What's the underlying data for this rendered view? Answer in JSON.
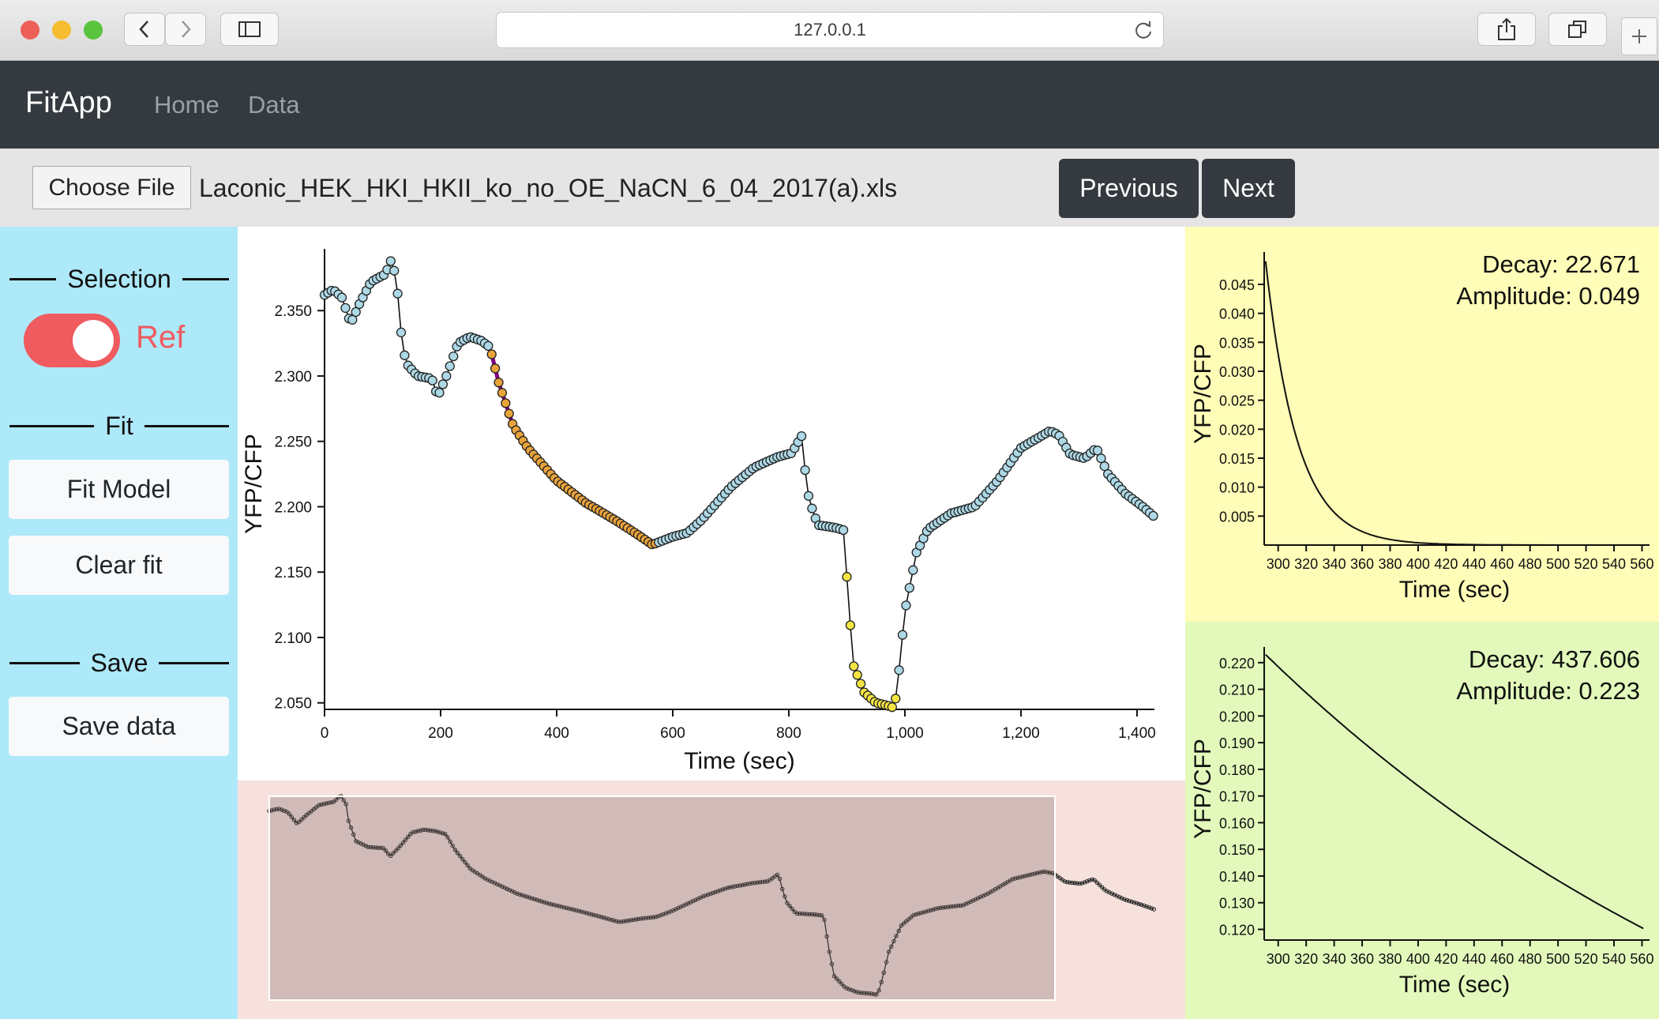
{
  "browser": {
    "url": "127.0.0.1"
  },
  "navbar": {
    "brand": "FitApp",
    "links": [
      "Home",
      "Data"
    ]
  },
  "file": {
    "choose_label": "Choose File",
    "filename": "Laconic_HEK_HKI_HKII_ko_no_OE_NaCN_6_04_2017(a).xls",
    "previous_label": "Previous",
    "next_label": "Next"
  },
  "sidebar": {
    "selection_title": "Selection",
    "toggle_label": "Ref",
    "toggle_on": true,
    "fit_title": "Fit",
    "fit_model_label": "Fit Model",
    "clear_fit_label": "Clear fit",
    "save_title": "Save",
    "save_data_label": "Save data"
  },
  "colors": {
    "accent_red": "#ef5b5f",
    "point_default": "#add8e6",
    "fit_segment": "#800080",
    "fit_points": "#e8a33b",
    "ref_points": "#f5e543"
  },
  "chart_data": [
    {
      "type": "scatter",
      "xlabel": "Time (sec)",
      "ylabel": "YFP/CFP",
      "xlim": [
        0,
        1430
      ],
      "ylim": [
        2.045,
        2.39
      ],
      "xticks": [
        "0",
        "200",
        "400",
        "600",
        "800",
        "1,000",
        "1,200",
        "1,400"
      ],
      "yticks": [
        "2.050",
        "2.100",
        "2.150",
        "2.200",
        "2.250",
        "2.300",
        "2.350"
      ],
      "trace_keypoints": [
        [
          0,
          2.362
        ],
        [
          15,
          2.366
        ],
        [
          30,
          2.36
        ],
        [
          45,
          2.34
        ],
        [
          60,
          2.355
        ],
        [
          80,
          2.372
        ],
        [
          105,
          2.378
        ],
        [
          115,
          2.389
        ],
        [
          125,
          2.372
        ],
        [
          128,
          2.345
        ],
        [
          140,
          2.31
        ],
        [
          160,
          2.3
        ],
        [
          185,
          2.298
        ],
        [
          195,
          2.284
        ],
        [
          210,
          2.3
        ],
        [
          230,
          2.325
        ],
        [
          250,
          2.33
        ],
        [
          270,
          2.327
        ],
        [
          285,
          2.322
        ],
        [
          300,
          2.295
        ],
        [
          325,
          2.262
        ],
        [
          350,
          2.245
        ],
        [
          400,
          2.22
        ],
        [
          450,
          2.203
        ],
        [
          500,
          2.19
        ],
        [
          535,
          2.18
        ],
        [
          565,
          2.171
        ],
        [
          600,
          2.177
        ],
        [
          625,
          2.18
        ],
        [
          650,
          2.19
        ],
        [
          700,
          2.215
        ],
        [
          740,
          2.23
        ],
        [
          780,
          2.238
        ],
        [
          805,
          2.241
        ],
        [
          822,
          2.254
        ],
        [
          828,
          2.228
        ],
        [
          835,
          2.205
        ],
        [
          850,
          2.186
        ],
        [
          880,
          2.184
        ],
        [
          895,
          2.182
        ],
        [
          903,
          2.125
        ],
        [
          912,
          2.078
        ],
        [
          930,
          2.058
        ],
        [
          950,
          2.05
        ],
        [
          970,
          2.048
        ],
        [
          982,
          2.046
        ],
        [
          990,
          2.075
        ],
        [
          1000,
          2.12
        ],
        [
          1020,
          2.165
        ],
        [
          1040,
          2.183
        ],
        [
          1080,
          2.195
        ],
        [
          1120,
          2.2
        ],
        [
          1160,
          2.22
        ],
        [
          1200,
          2.245
        ],
        [
          1250,
          2.258
        ],
        [
          1265,
          2.255
        ],
        [
          1285,
          2.24
        ],
        [
          1310,
          2.237
        ],
        [
          1330,
          2.245
        ],
        [
          1350,
          2.225
        ],
        [
          1380,
          2.21
        ],
        [
          1410,
          2.2
        ],
        [
          1428,
          2.193
        ]
      ],
      "fit_range": [
        285,
        570
      ],
      "reference_range": [
        895,
        985
      ]
    },
    {
      "type": "line",
      "title": "Decay: 22.671",
      "subtitle": "Amplitude: 0.049",
      "xlabel": "Time (sec)",
      "ylabel": "YFP/CFP",
      "xticks": [
        "300",
        "320",
        "340",
        "360",
        "380",
        "400",
        "420",
        "440",
        "460",
        "480",
        "500",
        "520",
        "540",
        "560"
      ],
      "yticks": [
        "0.005",
        "0.010",
        "0.015",
        "0.020",
        "0.025",
        "0.030",
        "0.035",
        "0.040",
        "0.045"
      ],
      "ylim": [
        0,
        0.0495
      ],
      "xlim": [
        290,
        562
      ],
      "decay": 22.671,
      "amplitude": 0.049
    },
    {
      "type": "line",
      "title": "Decay: 437.606",
      "subtitle": "Amplitude: 0.223",
      "xlabel": "Time (sec)",
      "ylabel": "YFP/CFP",
      "xticks": [
        "300",
        "320",
        "340",
        "360",
        "380",
        "400",
        "420",
        "440",
        "460",
        "480",
        "500",
        "520",
        "540",
        "560"
      ],
      "yticks": [
        "0.120",
        "0.130",
        "0.140",
        "0.150",
        "0.160",
        "0.170",
        "0.180",
        "0.190",
        "0.200",
        "0.210",
        "0.220"
      ],
      "ylim": [
        0.116,
        0.2235
      ],
      "xlim": [
        290,
        562
      ],
      "decay": 437.606,
      "amplitude": 0.223
    }
  ]
}
